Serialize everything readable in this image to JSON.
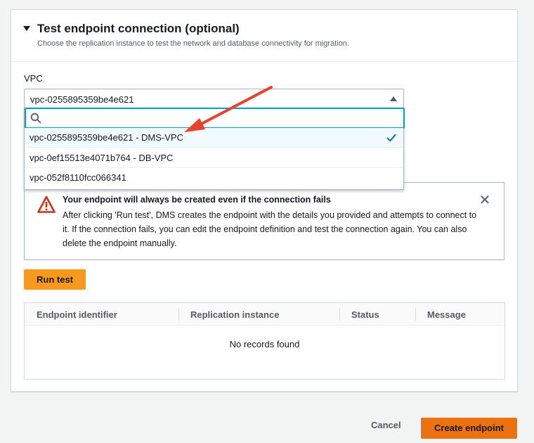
{
  "section": {
    "title": "Test endpoint connection (optional)",
    "description": "Choose the replication instance to test the network and database connectivity for migration."
  },
  "vpc": {
    "label": "VPC",
    "selected_value": "vpc-0255895359be4e621",
    "search_placeholder": "",
    "options": [
      {
        "label": "vpc-0255895359be4e621 - DMS-VPC",
        "selected": true
      },
      {
        "label": "vpc-0ef15513e4071b764 - DB-VPC",
        "selected": false
      },
      {
        "label": "vpc-052f8110fcc066341",
        "selected": false
      }
    ]
  },
  "alert": {
    "title": "Your endpoint will always be created even if the connection fails",
    "body": "After clicking 'Run test', DMS creates the endpoint with the details you provided and attempts to connect to it. If the connection fails, you can edit the endpoint definition and test the connection again. You can also delete the endpoint manually."
  },
  "run_test_label": "Run test",
  "table": {
    "headers": [
      "Endpoint identifier",
      "Replication instance",
      "Status",
      "Message"
    ],
    "empty_text": "No records found"
  },
  "footer": {
    "cancel_label": "Cancel",
    "create_label": "Create endpoint"
  },
  "colors": {
    "primary_button": "#ec7211",
    "focus": "#00a1c9",
    "check": "#0073bb",
    "warning": "#d13212",
    "annotation_arrow": "#e8412c"
  }
}
